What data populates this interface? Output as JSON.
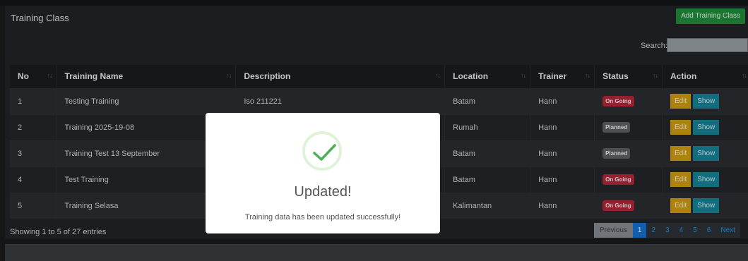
{
  "card": {
    "title": "Training Class",
    "add_button": "Add Training Class"
  },
  "search": {
    "label": "Search:",
    "value": "",
    "placeholder": ""
  },
  "table": {
    "headers": [
      "No",
      "Training Name",
      "Description",
      "Location",
      "Trainer",
      "Status",
      "Action"
    ],
    "rows": [
      {
        "no": "1",
        "name": "Testing Training",
        "description": "Iso 211221",
        "location": "Batam",
        "trainer": "Hann",
        "status": "On Going",
        "status_color": "#b8283a"
      },
      {
        "no": "2",
        "name": "Training 2025-19-08",
        "description": "",
        "location": "Rumah",
        "trainer": "Hann",
        "status": "Planned",
        "status_color": "#5e6166"
      },
      {
        "no": "3",
        "name": "Training Test 13 September",
        "description": "",
        "location": "Batam",
        "trainer": "Hann",
        "status": "Planned",
        "status_color": "#5e6166"
      },
      {
        "no": "4",
        "name": "Test Training",
        "description": "",
        "location": "Batam",
        "trainer": "Hann",
        "status": "On Going",
        "status_color": "#b8283a"
      },
      {
        "no": "5",
        "name": "Training Selasa",
        "description": "",
        "location": "Kalimantan",
        "trainer": "Hann",
        "status": "On Going",
        "status_color": "#b8283a"
      }
    ],
    "edit_label": "Edit",
    "show_label": "Show"
  },
  "info": "Showing 1 to 5 of 27 entries",
  "pagination": {
    "previous": "Previous",
    "pages": [
      "1",
      "2",
      "3",
      "4",
      "5",
      "6"
    ],
    "current": "1",
    "next": "Next"
  },
  "modal": {
    "icon": "check-icon",
    "title": "Updated!",
    "text": "Training data has been updated successfully!",
    "accent": "#32a852"
  }
}
